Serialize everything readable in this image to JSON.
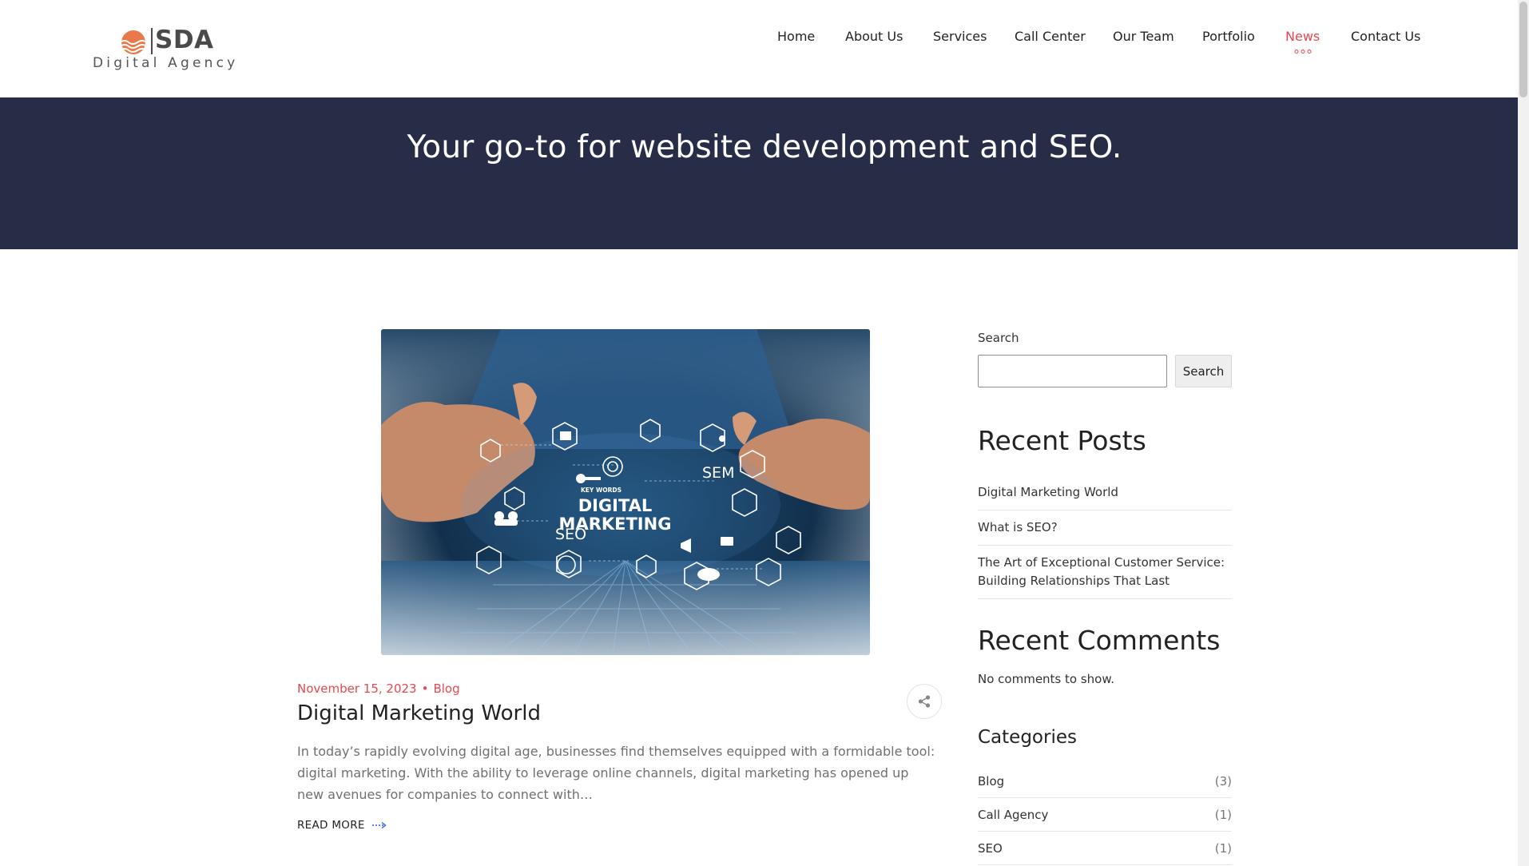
{
  "brand": {
    "name": "SDA",
    "tagline": "Digital Agency",
    "accent_color": "#e5484d",
    "logo_color": "#e9794a"
  },
  "nav": {
    "items": [
      {
        "label": "Home",
        "active": false
      },
      {
        "label": "About Us",
        "active": false
      },
      {
        "label": "Services",
        "active": false
      },
      {
        "label": "Call Center",
        "active": false
      },
      {
        "label": "Our Team",
        "active": false
      },
      {
        "label": "Portfolio",
        "active": false
      },
      {
        "label": "News",
        "active": true
      },
      {
        "label": "Contact Us",
        "active": false
      }
    ]
  },
  "hero": {
    "title": "Your go-to for website development and SEO.",
    "background": "#272d47"
  },
  "post": {
    "image_text": {
      "headline_line1": "DIGITAL",
      "headline_line2": "MARKETING",
      "seo": "SEO",
      "sem": "SEM",
      "keywords": "KEY WORDS"
    },
    "date": "November 15, 2023",
    "category": "Blog",
    "title": "Digital Marketing World",
    "excerpt": "In today’s rapidly evolving digital age, businesses find themselves equipped with a formidable tool: digital marketing. With the ability to leverage online channels, digital marketing has opened up new avenues for companies to connect with…",
    "read_more": "READ MORE",
    "share_icon": "share-icon"
  },
  "sidebar": {
    "search": {
      "label": "Search",
      "placeholder": "",
      "value": "",
      "button": "Search"
    },
    "recent_posts": {
      "title": "Recent Posts",
      "items": [
        "Digital Marketing World",
        "What is SEO?",
        "The Art of Exceptional Customer Service: Building Relationships That Last"
      ]
    },
    "recent_comments": {
      "title": "Recent Comments",
      "empty_text": "No comments to show."
    },
    "categories": {
      "title": "Categories",
      "items": [
        {
          "name": "Blog",
          "count": "(3)"
        },
        {
          "name": "Call Agency",
          "count": "(1)"
        },
        {
          "name": "SEO",
          "count": "(1)"
        }
      ]
    }
  }
}
